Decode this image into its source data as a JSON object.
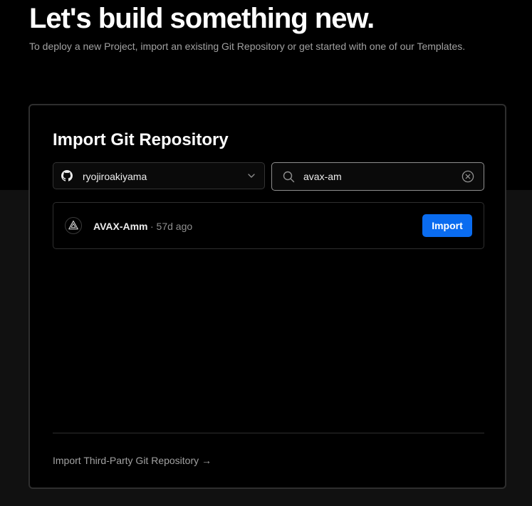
{
  "header": {
    "title": "Let's build something new.",
    "subtitle": "To deploy a new Project, import an existing Git Repository or get started with one of our Templates."
  },
  "import_card": {
    "title": "Import Git Repository",
    "scope_select": {
      "icon": "github-icon",
      "selected": "ryojiroakiyama"
    },
    "search": {
      "value": "avax-am",
      "icon": "search-icon",
      "clear_icon": "clear-circle-x-icon"
    },
    "repositories": [
      {
        "name": "AVAX-Amm",
        "updated": "· 57d ago",
        "icon": "framework-triangle-icon",
        "action_label": "Import"
      }
    ],
    "third_party_link": "Import Third-Party Git Repository →"
  },
  "colors": {
    "background": "#000000",
    "page_lower": "#111111",
    "accent": "#0a6cf0",
    "border": "#2e2e2e",
    "muted_text": "#a1a1a1"
  }
}
